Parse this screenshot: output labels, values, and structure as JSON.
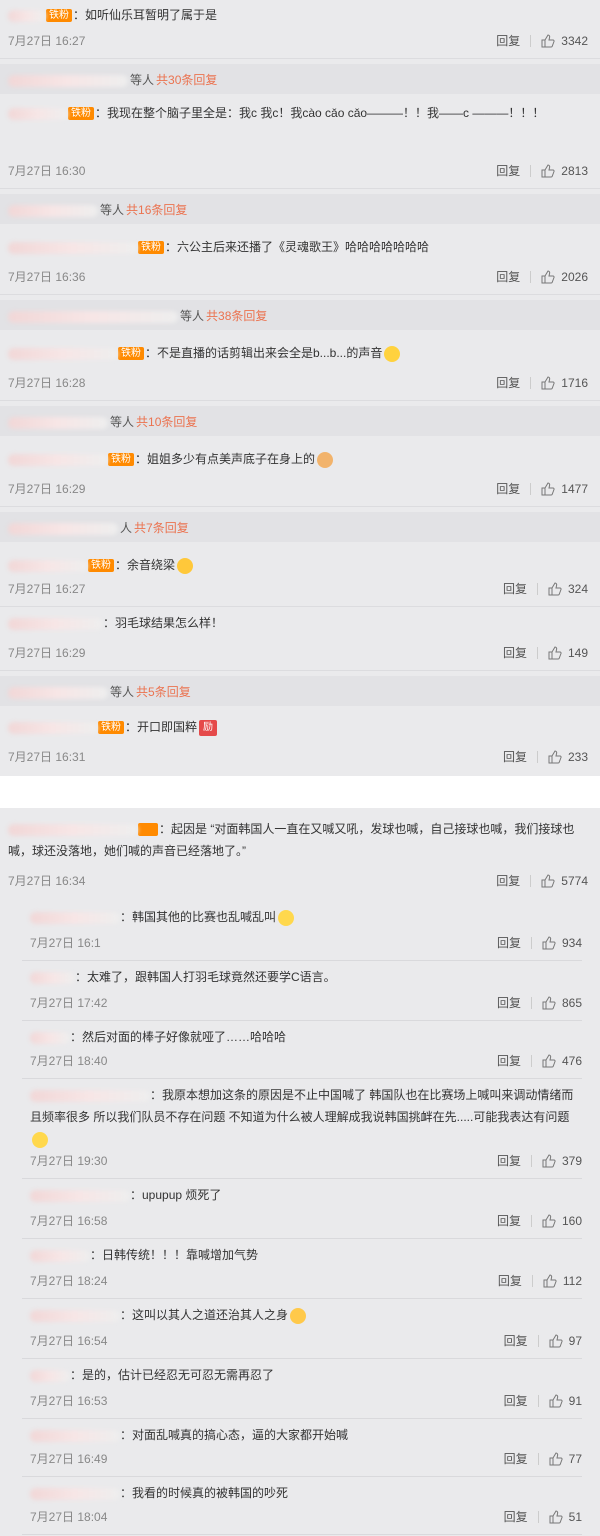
{
  "colors": {
    "panel_bg": "#eaeaec",
    "reply_count": "#eb7350",
    "badge": "#ff8a00"
  },
  "reply_label": "回复",
  "top_comments": [
    {
      "badge": "铁粉",
      "text": "：如听仙乐耳暂明了属于是",
      "time": "7月27日 16:27",
      "likes": "3342",
      "emoji": ""
    },
    {
      "reply_who": "等人",
      "reply_count": "共30条回复"
    },
    {
      "badge": "铁粉",
      "text": "：我现在整个脑子里全是：我c 我c！我cào cǎo cǎo———！！我——c ———！！！",
      "time": "7月27日 16:30",
      "likes": "2813",
      "emoji": ""
    },
    {
      "reply_who": "等人",
      "reply_count": "共16条回复"
    },
    {
      "badge": "铁粉",
      "text": "：六公主后来还播了《灵魂歌王》哈哈哈哈哈哈哈",
      "time": "7月27日 16:36",
      "likes": "2026",
      "emoji": ""
    },
    {
      "reply_who": "等人",
      "reply_count": "共38条回复"
    },
    {
      "badge": "铁粉",
      "text": "：不是直播的话剪辑出来会全是b...b...的声音",
      "time": "7月27日 16:28",
      "likes": "1716",
      "emoji": "smile"
    },
    {
      "reply_who": "等人",
      "reply_count": "共10条回复"
    },
    {
      "badge": "铁粉",
      "text": "：姐姐多少有点美声底子在身上的",
      "time": "7月27日 16:29",
      "likes": "1477",
      "emoji": "fist"
    },
    {
      "reply_who": "人",
      "reply_count": "共7条回复"
    },
    {
      "badge": "铁粉",
      "text": "：余音绕梁",
      "time": "7月27日 16:27",
      "likes": "324",
      "emoji": "love"
    },
    {
      "badge": "",
      "text": "：羽毛球结果怎么样！",
      "time": "7月27日 16:29",
      "likes": "149",
      "emoji": ""
    },
    {
      "reply_who": "等人",
      "reply_count": "共5条回复"
    },
    {
      "badge": "铁粉",
      "text": "：开口即国粹",
      "time": "7月27日 16:31",
      "likes": "233",
      "emoji": "tag",
      "emoji_text": "励"
    }
  ],
  "main_comment": {
    "text": "：起因是 “对面韩国人一直在又喊又吼，发球也喊，自己接球也喊，我们接球也喊，球还没落地，她们喊的声音已经落地了。”",
    "time": "7月27日 16:34",
    "likes": "5774"
  },
  "sub_replies": [
    {
      "text": "：韩国其他的比赛也乱喊乱叫",
      "time": "7月27日 16:1",
      "likes": "934",
      "emoji": "sweat"
    },
    {
      "text": "：太难了，跟韩国人打羽毛球竟然还要学C语言。",
      "time": "7月27日 17:42",
      "likes": "865",
      "emoji": ""
    },
    {
      "text": "：然后对面的棒子好像就哑了……哈哈哈",
      "time": "7月27日 18:40",
      "likes": "476",
      "emoji": ""
    },
    {
      "text": "：我原本想加这条的原因是不止中国喊了 韩国队也在比赛场上喊叫来调动情绪而且频率很多 所以我们队员不存在问题 不知道为什么被人理解成我说韩国挑衅在先.....可能我表达有问题",
      "time": "7月27日 19:30",
      "likes": "379",
      "emoji": "cry"
    },
    {
      "text": "：upupup 烦死了",
      "time": "7月27日 16:58",
      "likes": "160",
      "emoji": ""
    },
    {
      "text": "：日韩传统！！！靠喊增加气势",
      "time": "7月27日 18:24",
      "likes": "112",
      "emoji": ""
    },
    {
      "text": "：这叫以其人之道还治其人之身",
      "time": "7月27日 16:54",
      "likes": "97",
      "emoji": "wink"
    },
    {
      "text": "：是的，估计已经忍无可忍无需再忍了",
      "time": "7月27日 16:53",
      "likes": "91",
      "emoji": ""
    },
    {
      "text": "：对面乱喊真的搞心态，逼的大家都开始喊",
      "time": "7月27日 16:49",
      "likes": "77",
      "emoji": ""
    },
    {
      "text": "：我看的时候真的被韩国的吵死",
      "time": "7月27日 18:04",
      "likes": "51",
      "emoji": ""
    }
  ]
}
